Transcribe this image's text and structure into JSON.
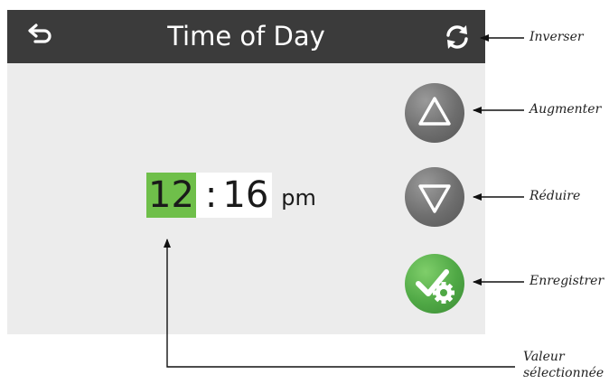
{
  "screen": {
    "title": "Time of Day",
    "back_icon": "back-arrow-icon",
    "refresh_icon": "refresh-icon"
  },
  "time": {
    "hours": "12",
    "separator": ":",
    "minutes": "16",
    "ampm": "pm",
    "selected_segment": "hours"
  },
  "buttons": {
    "up_icon": "triangle-up-icon",
    "down_icon": "triangle-down-icon",
    "save_icon": "check-gear-icon"
  },
  "annotations": {
    "invert": "Inverser",
    "increase": "Augmenter",
    "decrease": "Réduire",
    "save": "Enregistrer",
    "selected_value_line1": "Valeur",
    "selected_value_line2": "sélectionnée"
  },
  "colors": {
    "header_bg": "#3b3b3b",
    "screen_bg": "#ececec",
    "selected_highlight": "#6fbf4a",
    "save_green": "#4fa845",
    "button_gray": "#6e6e6e"
  }
}
